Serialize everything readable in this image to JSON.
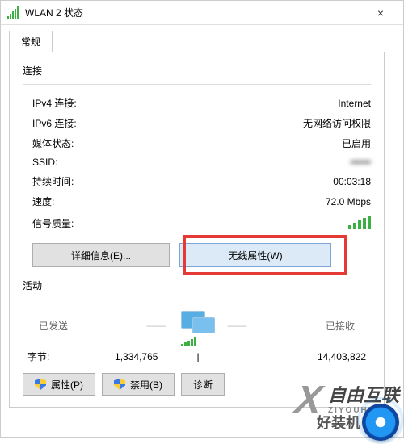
{
  "window": {
    "title": "WLAN 2 状态",
    "close_label": "×"
  },
  "tabs": {
    "general": "常规"
  },
  "connection": {
    "section_label": "连接",
    "ipv4_label": "IPv4 连接:",
    "ipv4_value": "Internet",
    "ipv6_label": "IPv6 连接:",
    "ipv6_value": "无网络访问权限",
    "media_state_label": "媒体状态:",
    "media_state_value": "已启用",
    "ssid_label": "SSID:",
    "ssid_value": "••••••",
    "duration_label": "持续时间:",
    "duration_value": "00:03:18",
    "speed_label": "速度:",
    "speed_value": "72.0 Mbps",
    "signal_quality_label": "信号质量:"
  },
  "buttons": {
    "details": "详细信息(E)...",
    "wireless_props": "无线属性(W)",
    "properties": "属性(P)",
    "disable": "禁用(B)",
    "diagnose": "诊断"
  },
  "activity": {
    "section_label": "活动",
    "sent_label": "已发送",
    "received_label": "已接收",
    "bytes_label": "字节:",
    "bytes_sent": "1,334,765",
    "bytes_received": "14,403,822"
  },
  "watermark": {
    "brand_cn": "自由互联",
    "brand_en": "ZIYOUHUIL",
    "tag": "好装机"
  }
}
